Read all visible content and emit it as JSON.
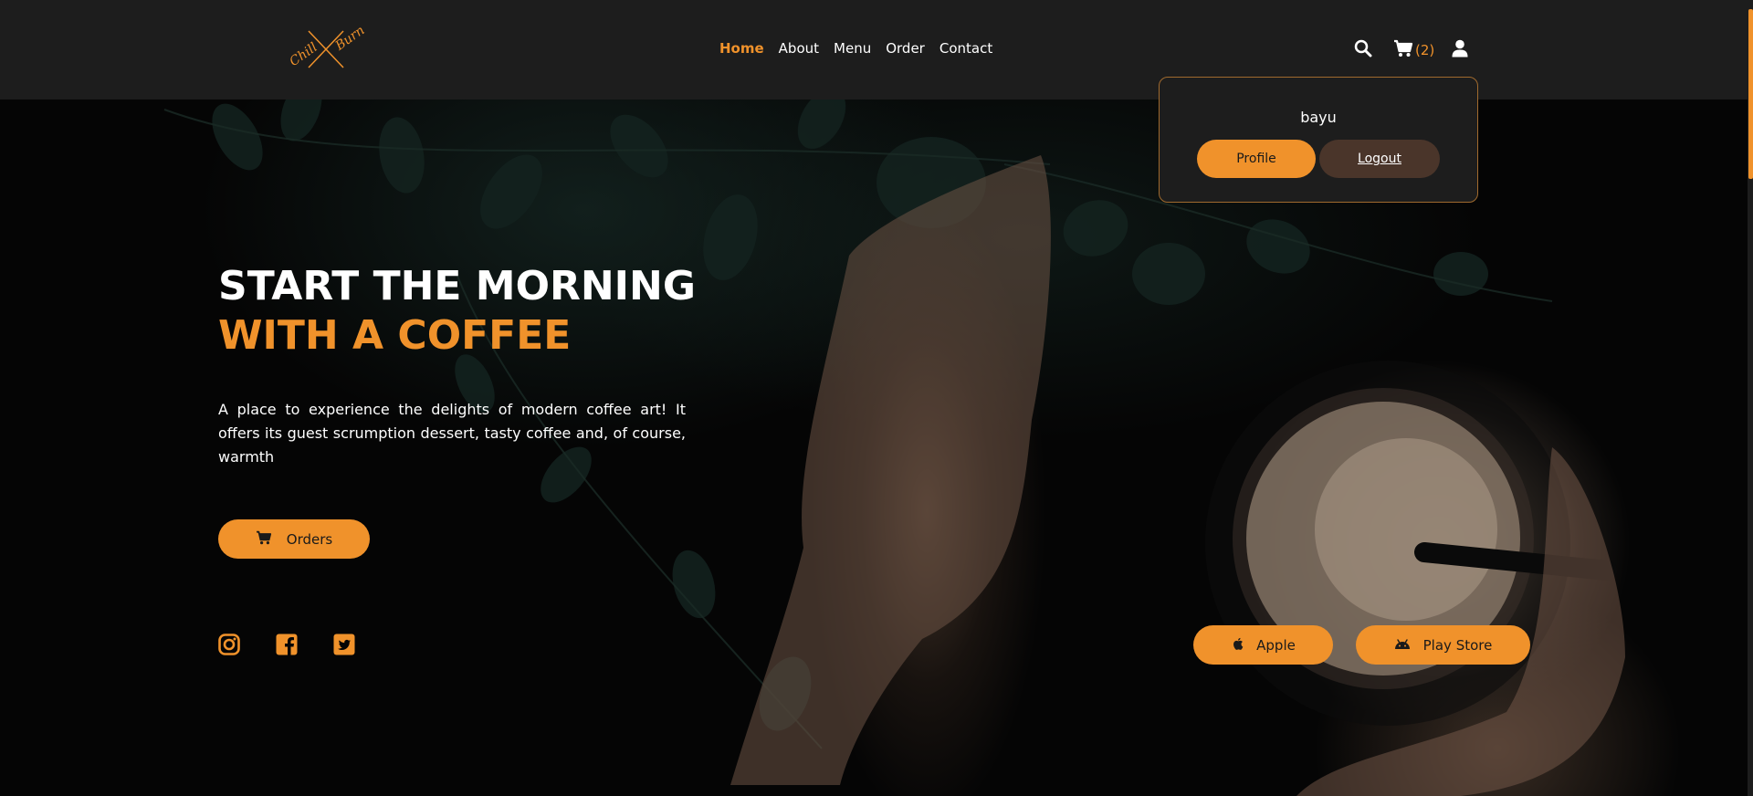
{
  "brand": {
    "logo_text_1": "Chill",
    "logo_text_2": "Burn",
    "accent_color": "#f0922b"
  },
  "nav": {
    "items": [
      {
        "label": "Home",
        "active": true
      },
      {
        "label": "About",
        "active": false
      },
      {
        "label": "Menu",
        "active": false
      },
      {
        "label": "Order",
        "active": false
      },
      {
        "label": "Contact",
        "active": false
      }
    ]
  },
  "header_icons": {
    "search": "search-icon",
    "cart": "cart-icon",
    "cart_count": "(2)",
    "user": "user-icon"
  },
  "account_menu": {
    "username": "bayu",
    "profile_label": "Profile",
    "logout_label": "Logout"
  },
  "hero": {
    "title_line_1": "START THE MORNING",
    "title_line_2": "WITH A COFFEE",
    "description": "A place to experience the delights of modern coffee art! It offers its guest scrumption dessert, tasty coffee and, of course, warmth",
    "orders_label": "Orders"
  },
  "social": [
    "instagram-icon",
    "facebook-icon",
    "twitter-icon"
  ],
  "stores": {
    "apple_label": "Apple",
    "playstore_label": "Play Store"
  }
}
